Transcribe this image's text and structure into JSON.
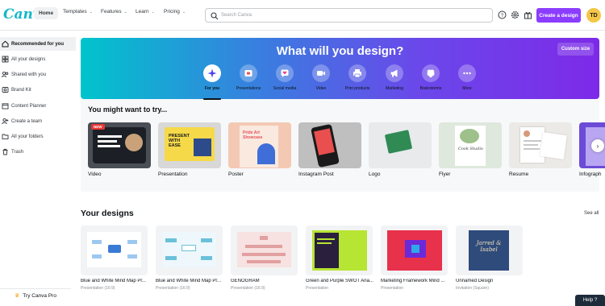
{
  "app": {
    "logo": "Canva"
  },
  "topnav": {
    "home": "Home",
    "templates": "Templates",
    "features": "Features",
    "learn": "Learn",
    "pricing": "Pricing"
  },
  "search": {
    "placeholder": "Search Canva"
  },
  "header": {
    "create_button": "Create a design",
    "avatar_initials": "TD"
  },
  "sidebar": {
    "items": [
      {
        "label": "Recommended for you",
        "icon": "home-icon"
      },
      {
        "label": "All your designs",
        "icon": "grid-icon"
      },
      {
        "label": "Shared with you",
        "icon": "people-icon"
      },
      {
        "label": "Brand Kit",
        "icon": "brand-icon"
      },
      {
        "label": "Content Planner",
        "icon": "calendar-icon"
      },
      {
        "label": "Create a team",
        "icon": "team-icon"
      },
      {
        "label": "All your folders",
        "icon": "folder-icon"
      },
      {
        "label": "Trash",
        "icon": "trash-icon"
      }
    ],
    "try_pro": "Try Canva Pro"
  },
  "banner": {
    "title": "What will you design?",
    "custom_size": "Custom size",
    "categories": [
      {
        "label": "For you",
        "icon": "sparkle-icon"
      },
      {
        "label": "Presentations",
        "icon": "presentation-icon"
      },
      {
        "label": "Social media",
        "icon": "heart-chat-icon"
      },
      {
        "label": "Video",
        "icon": "video-icon"
      },
      {
        "label": "Print products",
        "icon": "printer-icon"
      },
      {
        "label": "Marketing",
        "icon": "megaphone-icon"
      },
      {
        "label": "Brainstorms",
        "icon": "brain-icon"
      },
      {
        "label": "More",
        "icon": "more-icon"
      }
    ]
  },
  "try_section": {
    "heading": "You might want to try...",
    "items": [
      {
        "label": "Video",
        "badge": "NEW"
      },
      {
        "label": "Presentation",
        "thumb_text": "PRESENT WITH EASE"
      },
      {
        "label": "Poster",
        "thumb_text": "Pride Art Showcase"
      },
      {
        "label": "Instagram Post"
      },
      {
        "label": "Logo"
      },
      {
        "label": "Flyer",
        "thumb_text": "Cook Studio"
      },
      {
        "label": "Resume"
      },
      {
        "label": "Infograph"
      }
    ]
  },
  "designs_section": {
    "heading": "Your designs",
    "see_all": "See all",
    "items": [
      {
        "title": "Blue and White Mind Map Pr...",
        "subtitle": "Presentation (16:9)"
      },
      {
        "title": "Blue and White Mind Map Pr...",
        "subtitle": "Presentation (16:9)"
      },
      {
        "title": "GENOGRAM",
        "subtitle": "Presentation (16:9)"
      },
      {
        "title": "Green and Purple SWOT Ana...",
        "subtitle": "Presentation"
      },
      {
        "title": "Marketing Framework Mind ...",
        "subtitle": "Presentation"
      },
      {
        "title": "Unnamed Design",
        "subtitle": "Invitation (Square)",
        "thumb_text": "Jarred & Isabel"
      }
    ]
  },
  "help": {
    "label": "Help ?"
  },
  "colors": {
    "accent": "#8b3dff",
    "logo": "#14b8c7",
    "avatar": "#f3c646"
  }
}
